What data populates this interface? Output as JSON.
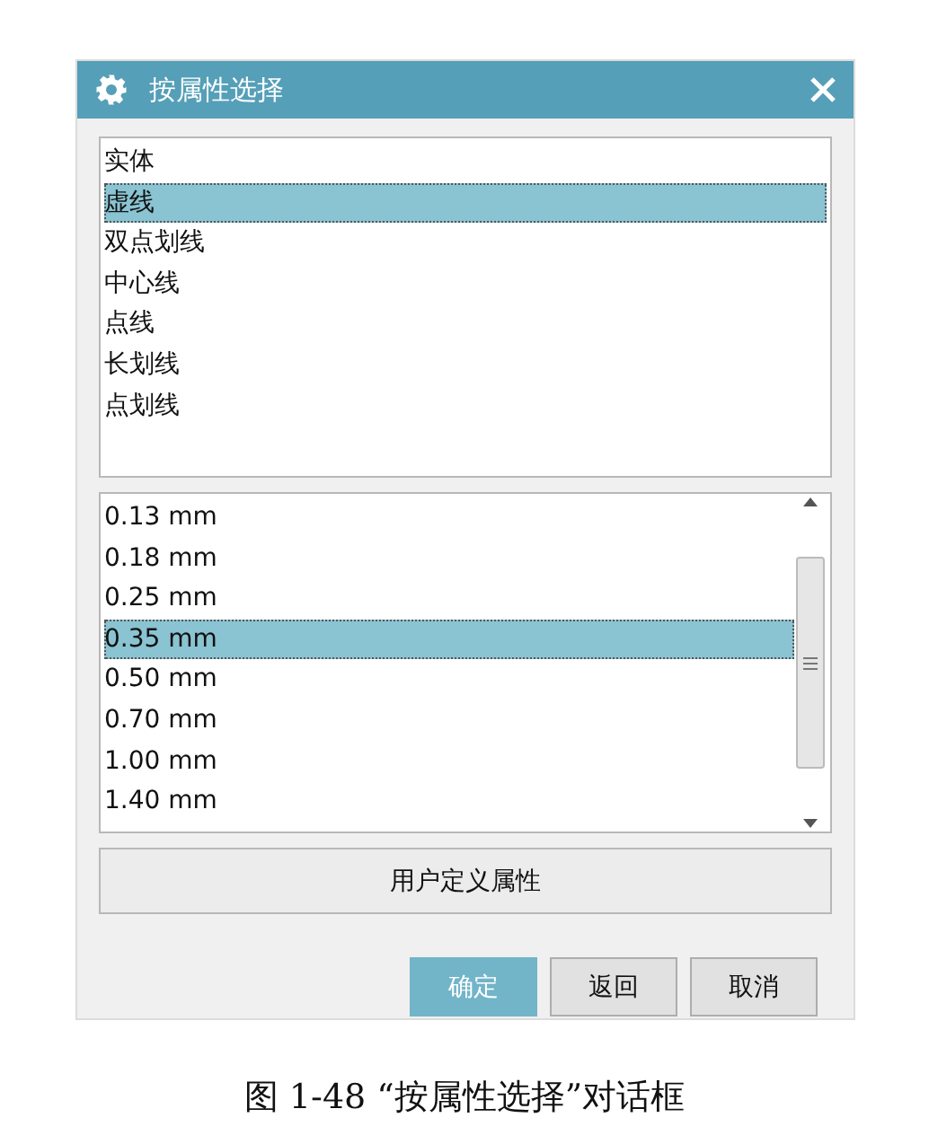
{
  "window": {
    "title": "按属性选择"
  },
  "line_types": [
    {
      "label": "实体",
      "selected": false
    },
    {
      "label": "虚线",
      "selected": true
    },
    {
      "label": "双点划线",
      "selected": false
    },
    {
      "label": "中心线",
      "selected": false
    },
    {
      "label": "点线",
      "selected": false
    },
    {
      "label": "长划线",
      "selected": false
    },
    {
      "label": "点划线",
      "selected": false
    }
  ],
  "widths": [
    {
      "label": "0.13 mm",
      "selected": false
    },
    {
      "label": "0.18 mm",
      "selected": false
    },
    {
      "label": "0.25 mm",
      "selected": false
    },
    {
      "label": "0.35 mm",
      "selected": true
    },
    {
      "label": "0.50 mm",
      "selected": false
    },
    {
      "label": "0.70 mm",
      "selected": false
    },
    {
      "label": "1.00 mm",
      "selected": false
    },
    {
      "label": "1.40 mm",
      "selected": false
    }
  ],
  "user_defined_button": "用户定义属性",
  "buttons": [
    {
      "label": "确定",
      "kind": "primary"
    },
    {
      "label": "返回",
      "kind": "normal"
    },
    {
      "label": "取消",
      "kind": "normal"
    }
  ],
  "caption": "图 1-48 “按属性选择”对话框"
}
